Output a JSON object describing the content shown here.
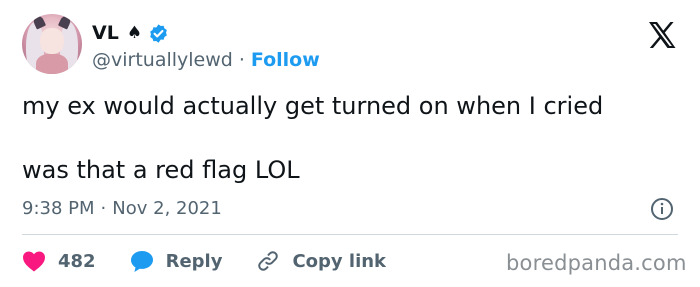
{
  "user": {
    "display_name": "VL",
    "handle": "@virtuallylewd",
    "separator": "·",
    "follow_label": "Follow"
  },
  "tweet": {
    "line1": "my ex would actually get turned on when I cried",
    "line2": "was that a red flag LOL",
    "time": "9:38 PM",
    "date_sep": "·",
    "date": "Nov 2, 2021"
  },
  "actions": {
    "like_count": "482",
    "reply_label": "Reply",
    "copy_label": "Copy link"
  },
  "watermark": "boredpanda.com",
  "colors": {
    "accent": "#1d9bf0",
    "like": "#f91880",
    "text": "#0f1419",
    "muted": "#536471"
  },
  "icons": [
    "spade-icon",
    "verified-icon",
    "x-logo-icon",
    "info-icon",
    "heart-icon",
    "reply-bubble-icon",
    "link-icon"
  ]
}
